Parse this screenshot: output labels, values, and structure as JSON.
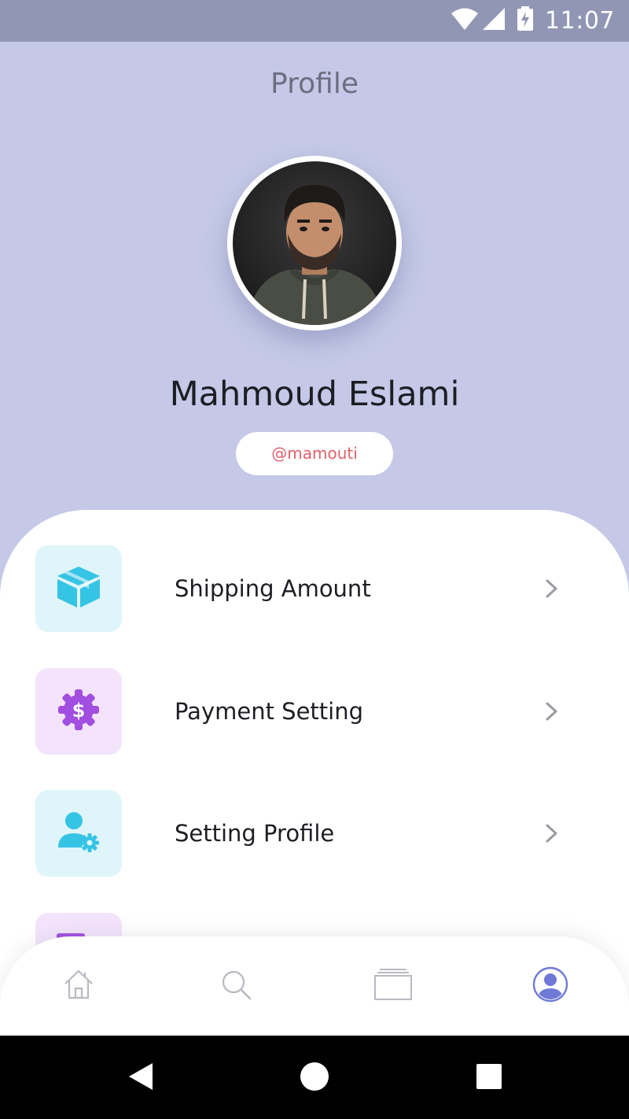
{
  "status_bar": {
    "time": "11:07",
    "icons": [
      "wifi-icon",
      "signal-icon",
      "battery-charging-icon"
    ]
  },
  "header": {
    "title": "Profile"
  },
  "profile": {
    "avatar_alt": "profile-photo",
    "name": "Mahmoud Eslami",
    "handle": "@mamouti"
  },
  "menu": {
    "items": [
      {
        "label": "Shipping Amount",
        "icon": "package-icon",
        "tint": "#dff5fa",
        "icon_color": "#36c4e4"
      },
      {
        "label": "Payment Setting",
        "icon": "dollar-gear-icon",
        "tint": "#f3e4fb",
        "icon_color": "#a24ee0"
      },
      {
        "label": "Setting Profile",
        "icon": "user-gear-icon",
        "tint": "#dff5fa",
        "icon_color": "#36c4e4"
      },
      {
        "label": "",
        "icon": "calendar-icon",
        "tint": "#f3e4fb",
        "icon_color": "#a24ee0"
      }
    ]
  },
  "bottom_nav": {
    "items": [
      {
        "name": "home",
        "icon": "home-icon",
        "active": false
      },
      {
        "name": "search",
        "icon": "search-icon",
        "active": false
      },
      {
        "name": "cards",
        "icon": "cards-icon",
        "active": false
      },
      {
        "name": "profile",
        "icon": "profile-icon",
        "active": true
      }
    ]
  },
  "colors": {
    "header_bg": "#c5c9e7",
    "status_bar_bg": "#9196b5",
    "accent": "#6f7ad6",
    "handle_text": "#e0606a"
  }
}
